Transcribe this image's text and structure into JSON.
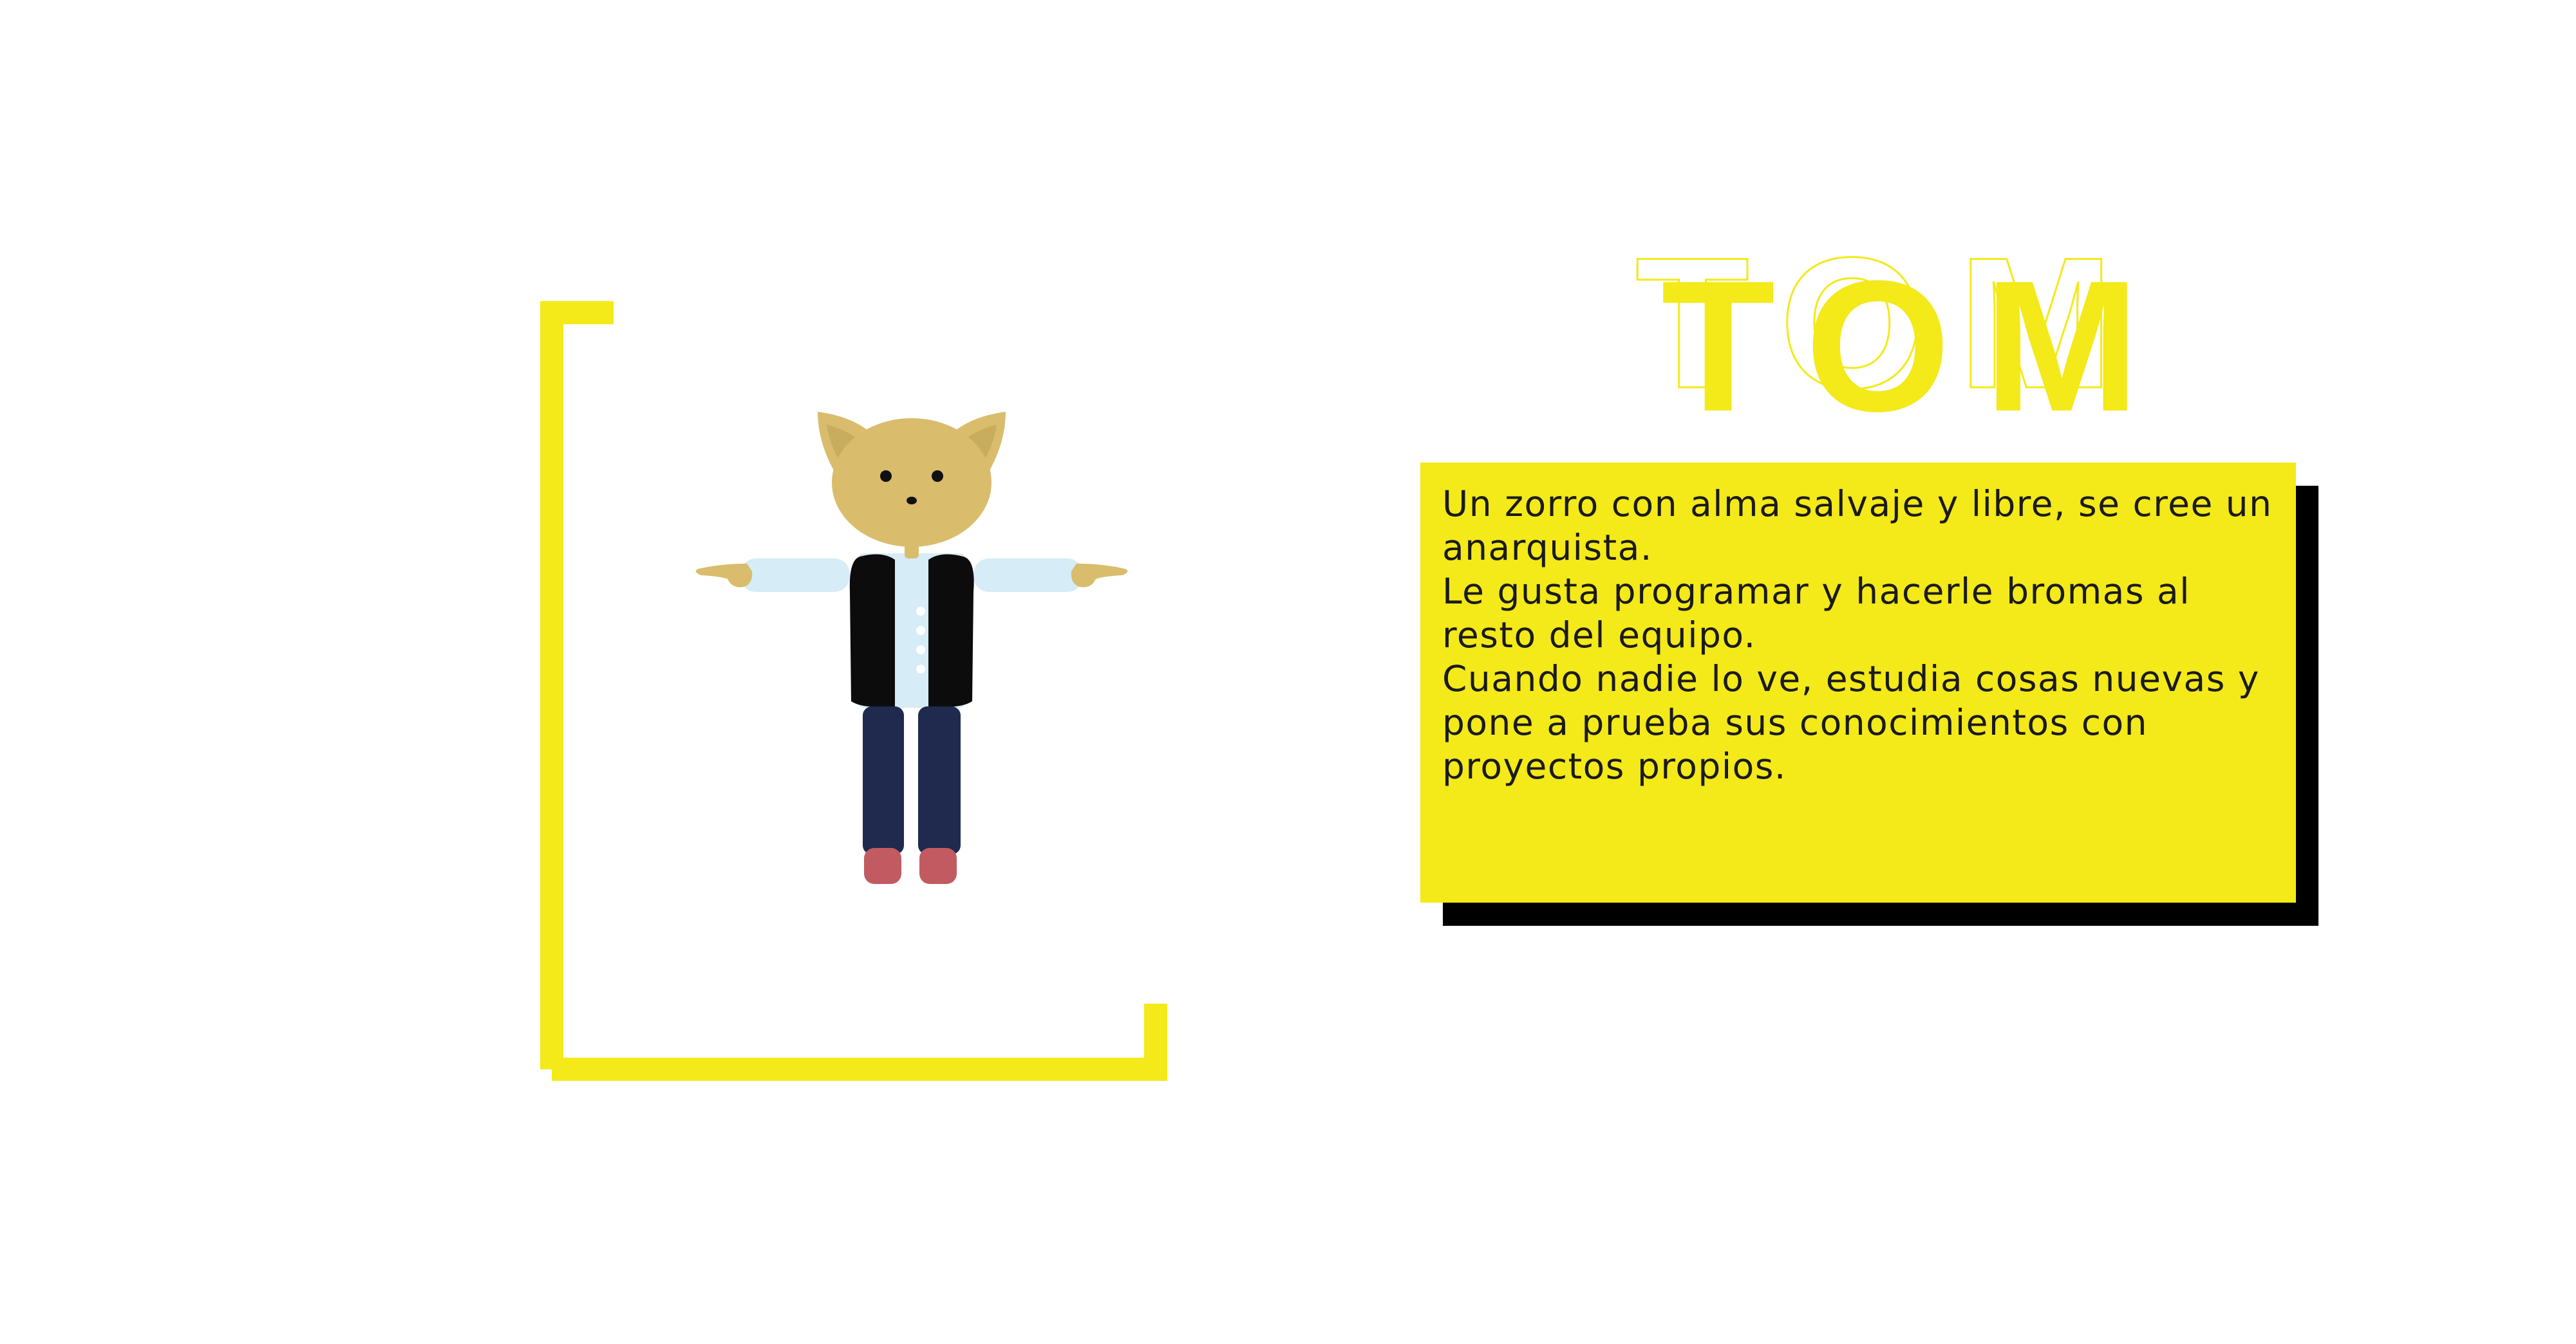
{
  "character": {
    "name": "TOM",
    "description_lines": [
      "Un zorro con alma salvaje y libre, se cree un anarquista.",
      "Le gusta programar y hacerle bromas al resto del equipo.",
      "Cuando nadie lo ve, estudia cosas nuevas y pone a prueba sus conocimientos con proyectos propios."
    ],
    "figure_icon": "fox-character-illustration"
  },
  "colors": {
    "accent_yellow": "#f4e919",
    "shadow_black": "#000000",
    "text_dark": "#1a1a1a",
    "fur": "#d9bd6c",
    "shirt": "#d6ecf6",
    "vest": "#0c0c0c",
    "pants": "#1f2a4e",
    "shoes": "#c25b61"
  }
}
